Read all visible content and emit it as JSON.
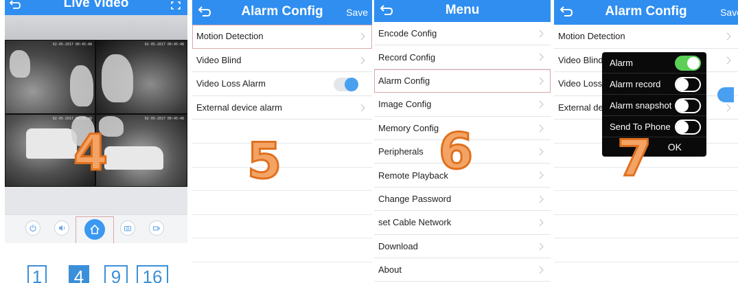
{
  "panel1": {
    "title": "Live Video",
    "cam_timestamps": [
      "02-05-2017 00:45:48",
      "02-05-2017 00:45:48",
      "02-05-2017 00:45:48",
      "02-05-2017 00:45:48"
    ],
    "step": "4",
    "controls": [
      "power-icon",
      "speaker-icon",
      "home-icon",
      "snapshot-icon",
      "record-icon"
    ],
    "layouts": [
      "1",
      "4",
      "9",
      "16"
    ],
    "active_layout": "4"
  },
  "panel2": {
    "title": "Alarm Config",
    "save": "Save",
    "items": [
      "Motion Detection",
      "Video Blind",
      "Video Loss Alarm",
      "External device alarm"
    ],
    "video_loss_toggle": true,
    "step": "5"
  },
  "panel3": {
    "title": "Menu",
    "items": [
      "Encode Config",
      "Record Config",
      "Alarm Config",
      "Image Config",
      "Memory Config",
      "Peripherals",
      "Remote Playback",
      "Change Password",
      "set Cable Network",
      "Download",
      "About"
    ],
    "selected": "Alarm Config",
    "step": "6"
  },
  "panel4": {
    "title": "Alarm Config",
    "save": "Save",
    "items": [
      "Motion Detection",
      "Video Blind",
      "Video Loss",
      "External de"
    ],
    "popup": {
      "options": [
        {
          "label": "Alarm",
          "on": true
        },
        {
          "label": "Alarm record",
          "on": false
        },
        {
          "label": "Alarm snapshot",
          "on": false
        },
        {
          "label": "Send To Phone",
          "on": false
        }
      ],
      "ok": "OK"
    },
    "step": "7"
  },
  "colors": {
    "nav_blue": "#2f8ef0",
    "toggle_blue": "#4aa0f0",
    "switch_green": "#5cd056",
    "step_orange": "#f3a464"
  }
}
